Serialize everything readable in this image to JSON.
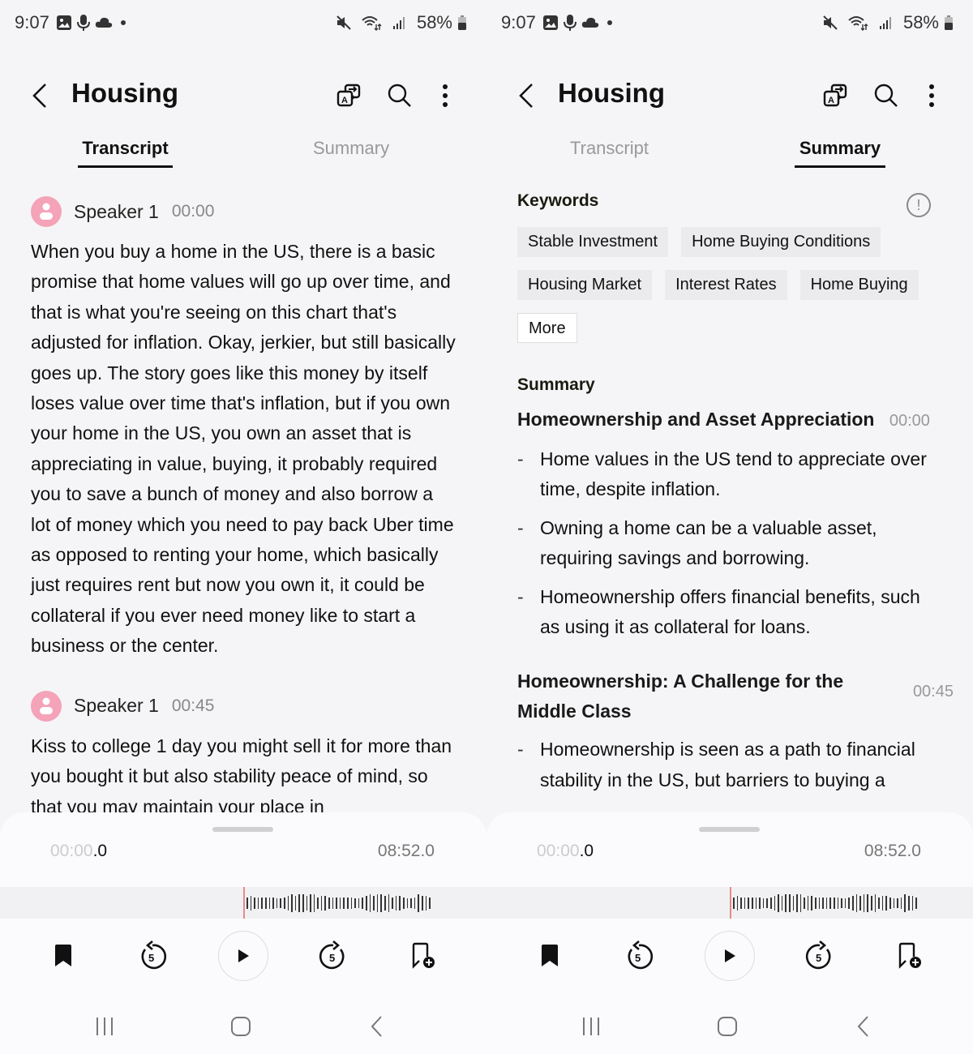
{
  "status_bar": {
    "time": "9:07",
    "left_icons": [
      "gallery-icon",
      "mic-icon",
      "cloud-icon",
      "dot-icon"
    ],
    "right_icons": [
      "mute-icon",
      "wifi-icon",
      "signal-icon"
    ],
    "battery": "58%"
  },
  "header": {
    "title": "Housing",
    "icons": [
      "translate-icon",
      "search-icon",
      "more-vert-icon"
    ]
  },
  "tabs": [
    {
      "label": "Transcript"
    },
    {
      "label": "Summary"
    }
  ],
  "left_screen": {
    "active_tab": "Transcript",
    "segments": [
      {
        "speaker": "Speaker 1",
        "time": "00:00",
        "text": "When you buy a home in the US, there is a basic promise that home values will go up over time, and that is what you're seeing on this chart that's adjusted for inflation. Okay, jerkier, but still basically goes up. The story goes like this money by itself loses value over time that's inflation, but if you own your home in the US, you own an asset that is appreciating in value, buying, it probably required you to save a bunch of money and also borrow a lot of money which you need to pay back Uber time as opposed to renting your home, which basically just requires rent but now you own it, it could be collateral if you ever need money like to start a business or the center."
      },
      {
        "speaker": "Speaker 1",
        "time": "00:45",
        "text": "Kiss to college 1 day you might sell it for more than you bought it but also stability peace of mind, so that you may maintain your place in"
      }
    ]
  },
  "right_screen": {
    "active_tab": "Summary",
    "keywords_label": "Keywords",
    "keywords": [
      "Stable Investment",
      "Home Buying Conditions",
      "Housing Market",
      "Interest Rates",
      "Home Buying"
    ],
    "more_label": "More",
    "summary_label": "Summary",
    "sections": [
      {
        "title": "Homeownership and Asset Appreciation",
        "time": "00:00",
        "bullets": [
          "Home values in the US tend to appreciate over time, despite inflation.",
          "Owning a home can be a valuable asset, requiring savings and borrowing.",
          "Homeownership offers financial benefits, such as using it as collateral for loans."
        ]
      },
      {
        "title": "Homeownership: A Challenge for the Middle Class",
        "time": "00:45",
        "bullets": [
          "Homeownership is seen as a path to financial stability in the US, but barriers to buying a"
        ]
      }
    ]
  },
  "player": {
    "current_time_main": "00:00",
    "current_time_sub": ".0",
    "total_time": "08:52.0",
    "progress": 0,
    "accent_color": "#e88a8a",
    "controls": [
      "bookmark-icon",
      "rewind-5-icon",
      "play-icon",
      "forward-5-icon",
      "add-bookmark-icon"
    ],
    "skip_seconds": "5"
  },
  "nav_bar": [
    "recents-icon",
    "home-icon",
    "back-icon"
  ],
  "dash": "-",
  "info_glyph": "!"
}
